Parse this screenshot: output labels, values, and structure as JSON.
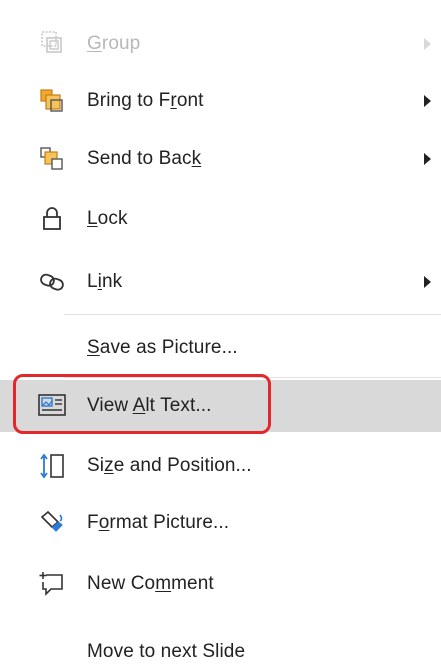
{
  "context_menu": {
    "items": [
      {
        "pre": "",
        "acc": "G",
        "post": "roup",
        "icon": "group-icon",
        "submenu": true,
        "disabled": true
      },
      {
        "pre": "Bring to F",
        "acc": "r",
        "post": "ont",
        "icon": "bring-to-front-icon",
        "submenu": true,
        "disabled": false
      },
      {
        "pre": "Send to Bac",
        "acc": "k",
        "post": "",
        "icon": "send-to-back-icon",
        "submenu": true,
        "disabled": false
      },
      {
        "pre": "",
        "acc": "L",
        "post": "ock",
        "icon": "lock-icon",
        "submenu": false,
        "disabled": false
      },
      {
        "pre": "L",
        "acc": "i",
        "post": "nk",
        "icon": "link-icon",
        "submenu": true,
        "disabled": false
      },
      {
        "pre": "",
        "acc": "S",
        "post": "ave as Picture...",
        "icon": "",
        "submenu": false,
        "disabled": false
      },
      {
        "pre": "View ",
        "acc": "A",
        "post": "lt Text...",
        "icon": "alt-text-icon",
        "submenu": false,
        "disabled": false,
        "highlighted": true
      },
      {
        "pre": "Si",
        "acc": "z",
        "post": "e and Position...",
        "icon": "size-position-icon",
        "submenu": false,
        "disabled": false
      },
      {
        "pre": "F",
        "acc": "o",
        "post": "rmat Picture...",
        "icon": "format-picture-icon",
        "submenu": false,
        "disabled": false
      },
      {
        "pre": "New Co",
        "acc": "m",
        "post": "ment",
        "icon": "new-comment-icon",
        "submenu": false,
        "disabled": false
      },
      {
        "pre": "Move to next Slide",
        "acc": "",
        "post": "",
        "icon": "",
        "submenu": false,
        "disabled": false
      }
    ]
  },
  "colors": {
    "highlight_bg": "#d9d9d9",
    "focus_ring": "#e3282b",
    "text": "#222222",
    "disabled_text": "#b8b8b8",
    "icon_orange": "#f0a830",
    "icon_blue": "#2b7cd3"
  }
}
